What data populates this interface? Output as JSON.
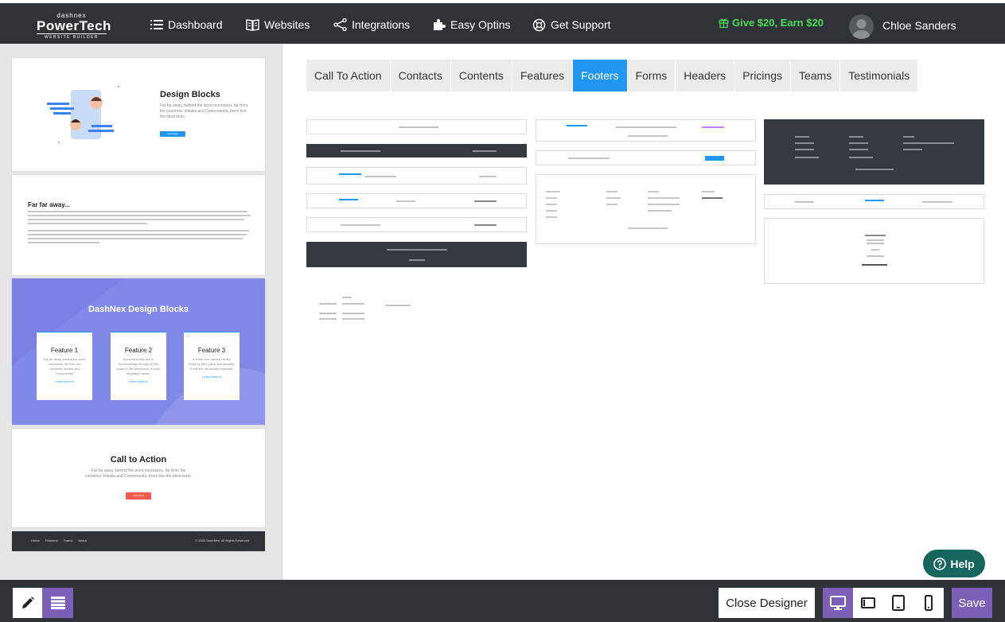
{
  "topbar": {
    "logo": {
      "small": "dashnex",
      "big": "PowerTech",
      "sub": "WEBSITE BUILDER"
    },
    "nav": [
      {
        "label": "Dashboard",
        "icon": "list-icon"
      },
      {
        "label": "Websites",
        "icon": "book-icon"
      },
      {
        "label": "Integrations",
        "icon": "share-icon"
      },
      {
        "label": "Easy Optins",
        "icon": "puzzle-icon"
      },
      {
        "label": "Get Support",
        "icon": "lifebuoy-icon"
      }
    ],
    "promo": "Give $20, Earn $20",
    "user_name": "Chloe Sanders"
  },
  "left_panel": {
    "card1": {
      "title": "Design Blocks",
      "text": "Far far away, behind the word mountains, far from the countries Vokalia and Consonantia, there live the blind texts.",
      "button": "Download"
    },
    "card2": {
      "title": "Far far away..."
    },
    "card3": {
      "title": "DashNex Design Blocks",
      "features": [
        {
          "title": "Feature 1",
          "text": "Far far away, behind the word mountains, far from the countries Vokalia and Consonantia",
          "link": "Learn More ▸"
        },
        {
          "title": "Feature 2",
          "text": "Separated they live in Bookmarksgrove right at the coast of the Semantics, a large language ocean.",
          "link": "Learn More ▸"
        },
        {
          "title": "Feature 3",
          "text": "A small river named Duden flows by their place and supplies it with the necessary regelialia.",
          "link": "Learn More ▸"
        }
      ]
    },
    "card4": {
      "title": "Call to Action",
      "text": "Far far away, behind the word mountains, far from the countries Vokalia and Consonantia, there live the blind texts.",
      "button": "Download"
    },
    "card5": {
      "links": "Home Features Teams About",
      "copyright": "© 2020 DashNex. All Rights Reserved"
    }
  },
  "tabs": [
    {
      "label": "Call To Action",
      "active": false
    },
    {
      "label": "Contacts",
      "active": false
    },
    {
      "label": "Contents",
      "active": false
    },
    {
      "label": "Features",
      "active": false
    },
    {
      "label": "Footers",
      "active": true
    },
    {
      "label": "Forms",
      "active": false
    },
    {
      "label": "Headers",
      "active": false
    },
    {
      "label": "Pricings",
      "active": false
    },
    {
      "label": "Teams",
      "active": false
    },
    {
      "label": "Testimonials",
      "active": false
    }
  ],
  "help_label": "Help",
  "bottombar": {
    "close_designer": "Close Designer",
    "save": "Save",
    "devices": [
      "desktop-icon",
      "tablet-landscape-icon",
      "tablet-icon",
      "phone-icon"
    ]
  },
  "colors": {
    "accent": "#2196f3",
    "purple": "#7c5fb7",
    "dark": "#2f3337",
    "promo": "#4ade5a",
    "help": "#17665e"
  }
}
